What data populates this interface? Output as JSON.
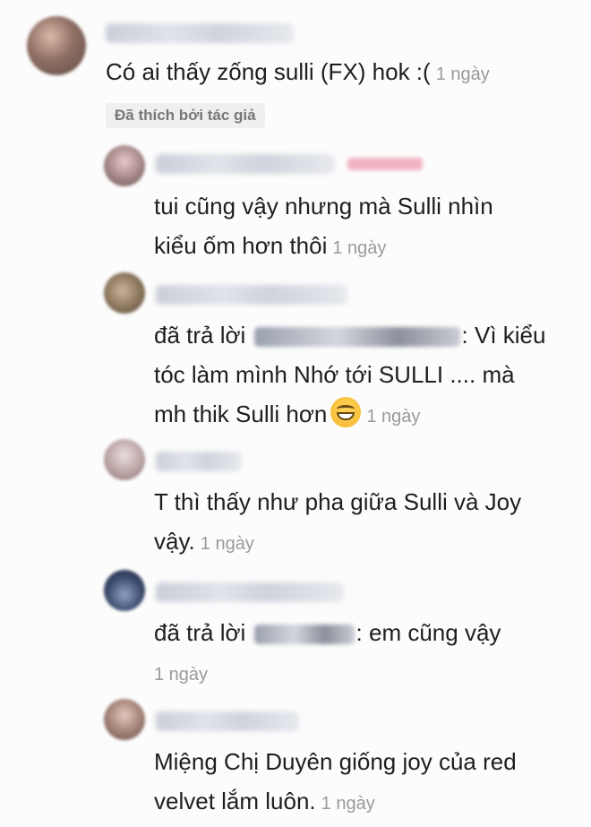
{
  "comments": [
    {
      "text": "Có ai thấy zống sulli (FX) hok :(",
      "time": "1 ngày",
      "badge": "Đã thích bởi tác giả"
    },
    {
      "line1": "tui cũng vậy nhưng mà Sulli nhìn",
      "line2": "kiểu ốm hơn thôi",
      "time": "1 ngày"
    },
    {
      "reply_prefix": "đã trả lời",
      "line1_suffix": ": Vì kiểu",
      "line2": "tóc làm mình Nhớ tới SULLI .... mà",
      "line3": "mh thik Sulli hơn",
      "emoji": "grinning-face-emoji",
      "time": "1 ngày"
    },
    {
      "line1": "T thì thấy như pha giữa Sulli và Joy",
      "line2": "vậy.",
      "time": "1 ngày"
    },
    {
      "reply_prefix": "đã trả lời",
      "line1_suffix": ": em cũng vậy",
      "time": "1 ngày"
    },
    {
      "line1": "Miệng Chị Duyên giống joy của red",
      "line2": "velvet lắm luôn.",
      "time": "1 ngày"
    }
  ]
}
